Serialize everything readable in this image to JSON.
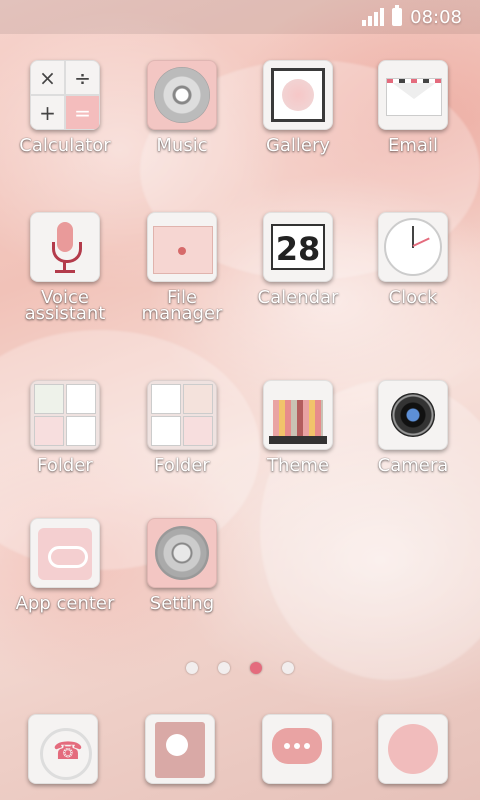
{
  "statusbar": {
    "time": "08:08"
  },
  "apps": [
    {
      "id": "calculator",
      "label": "Calculator"
    },
    {
      "id": "music",
      "label": "Music"
    },
    {
      "id": "gallery",
      "label": "Gallery"
    },
    {
      "id": "email",
      "label": "Email"
    },
    {
      "id": "voice",
      "label": "Voice\nassistant"
    },
    {
      "id": "filemgr",
      "label": "File\nmanager"
    },
    {
      "id": "calendar",
      "label": "Calendar"
    },
    {
      "id": "clock",
      "label": "Clock"
    },
    {
      "id": "folder1",
      "label": "Folder"
    },
    {
      "id": "folder2",
      "label": "Folder"
    },
    {
      "id": "theme",
      "label": "Theme"
    },
    {
      "id": "camera",
      "label": "Camera"
    },
    {
      "id": "appcenter",
      "label": "App center"
    },
    {
      "id": "setting",
      "label": "Setting"
    }
  ],
  "icons": {
    "calc_symbols": [
      "×",
      "÷",
      "+",
      "="
    ],
    "calendar_day": "28"
  },
  "pager": {
    "pages": 4,
    "active_index": 2
  },
  "dock": [
    {
      "id": "phone",
      "name": "phone-icon"
    },
    {
      "id": "contacts",
      "name": "contacts-icon"
    },
    {
      "id": "messages",
      "name": "messages-icon"
    },
    {
      "id": "browser",
      "name": "browser-icon"
    }
  ],
  "colors": {
    "accent": "#e46b7d",
    "wallpaper": "#f1c2b8"
  }
}
